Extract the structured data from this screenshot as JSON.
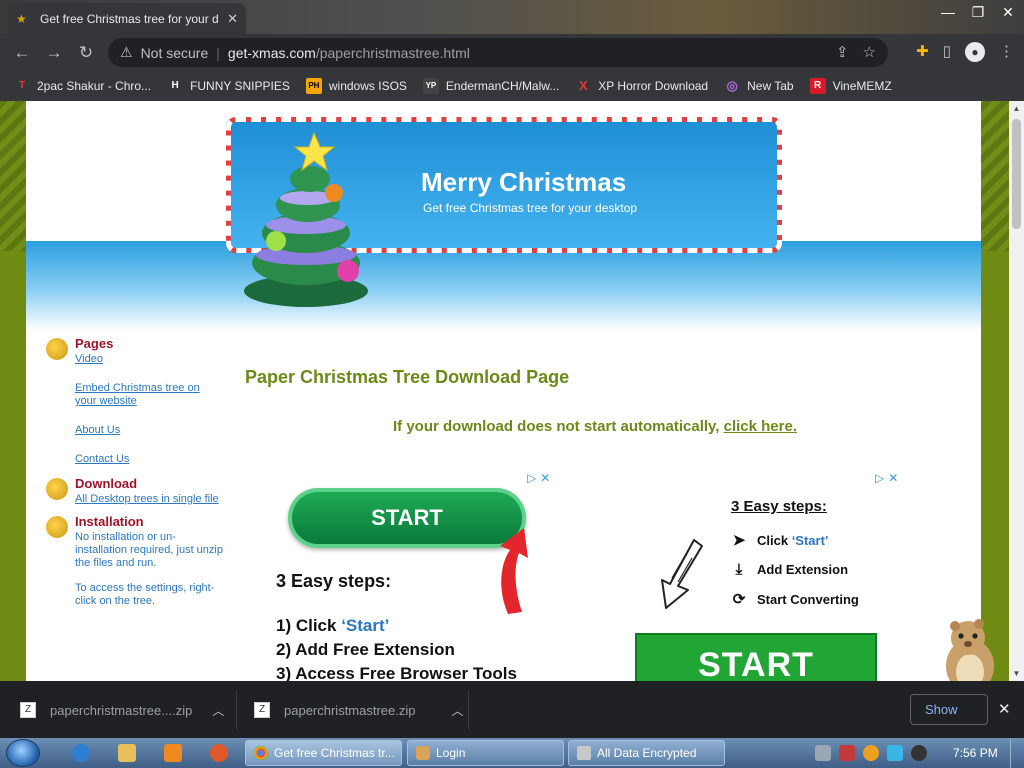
{
  "browser": {
    "tab_title": "Get free Christmas tree for your d",
    "url_warning": "Not secure",
    "url_host": "get-xmas.com",
    "url_path": "/paperchristmastree.html"
  },
  "bookmarks": [
    {
      "label": "2pac Shakur - Chro...",
      "icon": "T",
      "color": "#e53935"
    },
    {
      "label": "FUNNY SNIPPIES",
      "icon": "H",
      "color": "#ffffff"
    },
    {
      "label": "windows ISOS",
      "icon": "PH",
      "color": "#f7a600"
    },
    {
      "label": "EndermanCH/Malw...",
      "icon": "YP",
      "color": "#444444"
    },
    {
      "label": "XP Horror Download",
      "icon": "X",
      "color": "#e53935"
    },
    {
      "label": "New Tab",
      "icon": "◎",
      "color": "#b06ad6"
    },
    {
      "label": "VineMEMZ",
      "icon": "R",
      "color": "#d81b2a"
    }
  ],
  "header": {
    "title": "Merry Christmas",
    "subtitle": "Get free Christmas tree for your desktop"
  },
  "sidebar": {
    "pages_heading": "Pages",
    "pages_links": [
      "Video",
      "Embed Christmas tree on your website",
      "About Us",
      "Contact Us"
    ],
    "download_heading": "Download",
    "download_link": "All Desktop trees in single file",
    "install_heading": "Installation",
    "install_text1": "No installation or un-installation required, just unzip the files and run.",
    "install_text2": "To access the settings, right-click on the tree."
  },
  "main": {
    "title": "Paper Christmas Tree Download Page",
    "notice_text": "If your download does not start automatically,",
    "notice_link": "click here.",
    "start_button": "START",
    "steps_heading": "3 Easy steps:",
    "steps": {
      "s1_prefix": "1) Click ",
      "s1_highlight": "‘Start’",
      "s2": "2) Add Free Extension",
      "s3": "3) Access Free Browser Tools"
    }
  },
  "ad_right": {
    "heading": "3 Easy steps:",
    "row1_prefix": "Click ",
    "row1_highlight": "‘Start’",
    "row2": "Add Extension",
    "row3": "Start Converting",
    "big_button": "START"
  },
  "downloads": {
    "item1": "paperchristmastree....zip",
    "item2": "paperchristmastree.zip",
    "show_all": "Show"
  },
  "taskbar": {
    "task1": "Get free Christmas tr...",
    "task2": "Login",
    "task3": "All Data Encrypted",
    "clock": "7:56 PM"
  }
}
